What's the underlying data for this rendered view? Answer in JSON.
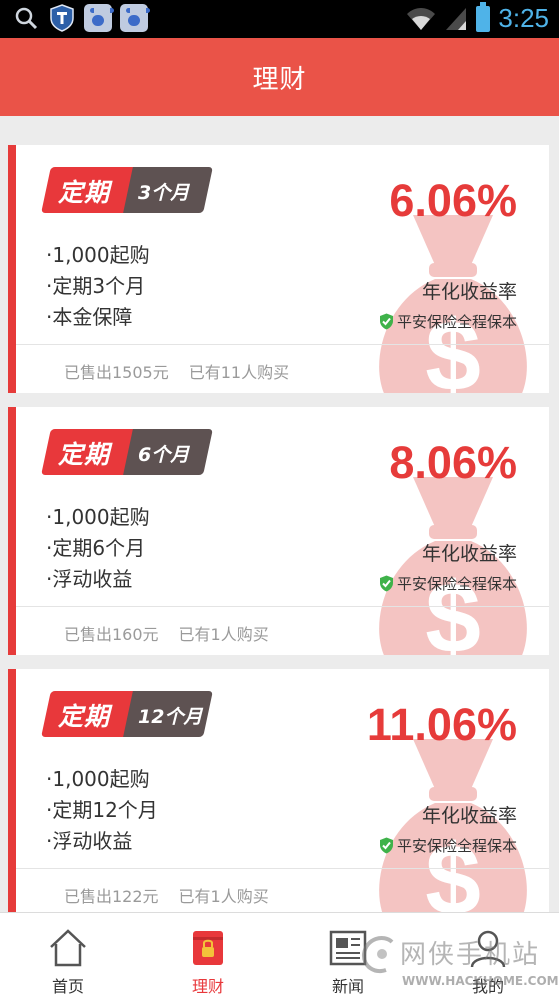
{
  "status_bar": {
    "time": "3:25",
    "left_icons": [
      "search-icon",
      "shield-app-icon",
      "baidu-icon",
      "baidu-icon"
    ],
    "right_icons": [
      "wifi-icon",
      "signal-icon",
      "battery-icon"
    ]
  },
  "header": {
    "title": "理财"
  },
  "colors": {
    "accent": "#ea5348",
    "card_accent": "#e63b3a",
    "badge_dark": "#5e5252",
    "muted": "#9a9a9a"
  },
  "products": [
    {
      "badge_type": "定期",
      "badge_term": "3个月",
      "rate": "6.06%",
      "features": [
        "·1,000起购",
        "·定期3个月",
        "·本金保障"
      ],
      "rate_label": "年化收益率",
      "insurance": "平安保险全程保本",
      "sold": "已售出1505元",
      "buyers": "已有11人购买"
    },
    {
      "badge_type": "定期",
      "badge_term": "6个月",
      "rate": "8.06%",
      "features": [
        "·1,000起购",
        "·定期6个月",
        "·浮动收益"
      ],
      "rate_label": "年化收益率",
      "insurance": "平安保险全程保本",
      "sold": "已售出160元",
      "buyers": "已有1人购买"
    },
    {
      "badge_type": "定期",
      "badge_term": "12个月",
      "rate": "11.06%",
      "features": [
        "·1,000起购",
        "·定期12个月",
        "·浮动收益"
      ],
      "rate_label": "年化收益率",
      "insurance": "平安保险全程保本",
      "sold": "已售出122元",
      "buyers": "已有1人购买"
    }
  ],
  "tabs": [
    {
      "label": "首页",
      "icon": "home-icon",
      "active": false
    },
    {
      "label": "理财",
      "icon": "finance-icon",
      "active": true
    },
    {
      "label": "新闻",
      "icon": "news-icon",
      "active": false
    },
    {
      "label": "我的",
      "icon": "profile-icon",
      "active": false
    }
  ],
  "watermark": {
    "text": "网侠手机站",
    "url": "WWW.HACKHOME.COM"
  }
}
